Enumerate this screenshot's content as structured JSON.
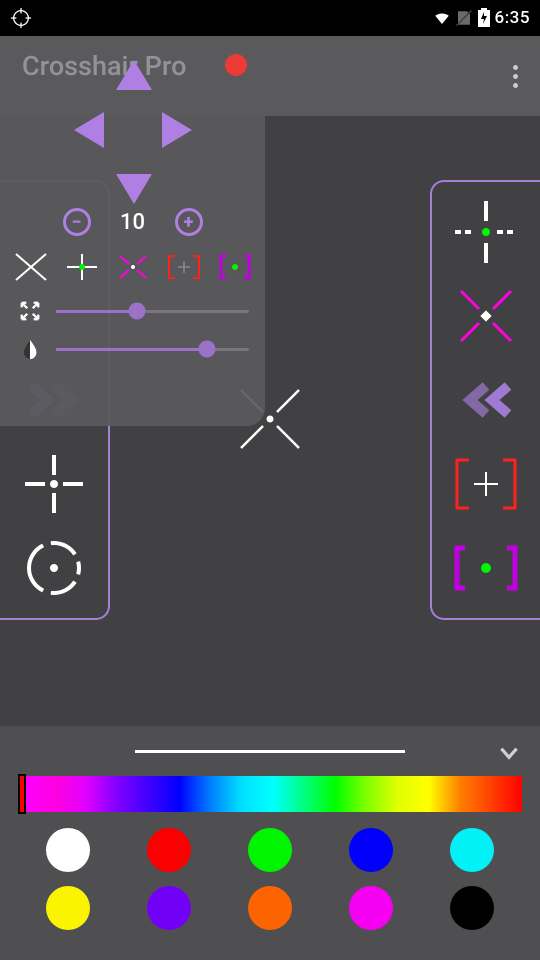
{
  "status": {
    "time": "6:35"
  },
  "app": {
    "title": "Crosshair Pro"
  },
  "overlay": {
    "size_value": "10",
    "slider_scale_pct": 42,
    "slider_opacity_pct": 78
  },
  "left_panel_items": [
    "x-gray",
    "green-plus",
    "chevrons",
    "plus",
    "scope"
  ],
  "right_panel_items": [
    "dash-plus",
    "x-magenta",
    "chevrons-purple",
    "brackets-red",
    "brackets-teal"
  ],
  "center_crosshair": "x-white",
  "drawer": {
    "swatches": [
      {
        "name": "white",
        "hex": "#ffffff"
      },
      {
        "name": "red",
        "hex": "#fb0000"
      },
      {
        "name": "green",
        "hex": "#00f600"
      },
      {
        "name": "blue",
        "hex": "#0000fb"
      },
      {
        "name": "cyan",
        "hex": "#00f2f7"
      },
      {
        "name": "yellow",
        "hex": "#faf400"
      },
      {
        "name": "purple",
        "hex": "#7200f6"
      },
      {
        "name": "orange",
        "hex": "#fb6400"
      },
      {
        "name": "magenta",
        "hex": "#f600f1"
      },
      {
        "name": "black",
        "hex": "#000000"
      }
    ]
  }
}
